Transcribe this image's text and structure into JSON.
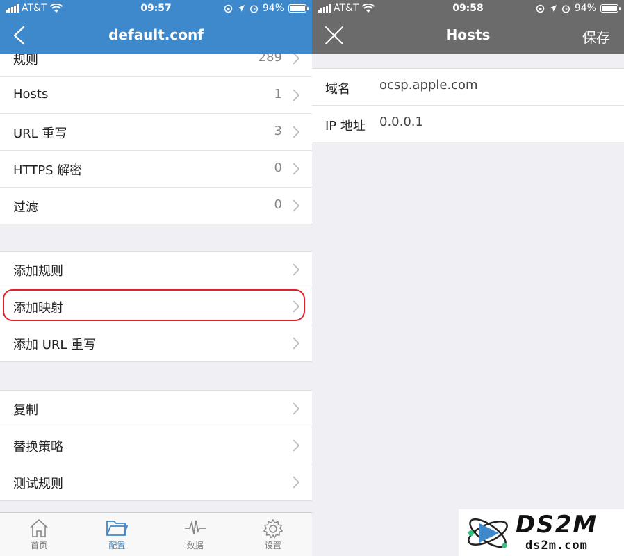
{
  "left": {
    "status": {
      "carrier": "AT&T",
      "time": "09:57",
      "battery": "94%"
    },
    "nav": {
      "title": "default.conf"
    },
    "groups": [
      {
        "rows": [
          {
            "label": "规则",
            "count": "289"
          },
          {
            "label": "Hosts",
            "count": "1"
          },
          {
            "label": "URL 重写",
            "count": "3"
          },
          {
            "label": "HTTPS 解密",
            "count": "0"
          },
          {
            "label": "过滤",
            "count": "0"
          }
        ]
      },
      {
        "rows": [
          {
            "label": "添加规则"
          },
          {
            "label": "添加映射"
          },
          {
            "label": "添加 URL 重写"
          }
        ]
      },
      {
        "rows": [
          {
            "label": "复制"
          },
          {
            "label": "替换策略"
          },
          {
            "label": "测试规则"
          }
        ]
      }
    ],
    "tabs": [
      {
        "label": "首页",
        "icon": "home-icon"
      },
      {
        "label": "配置",
        "icon": "folder-icon",
        "active": true
      },
      {
        "label": "数据",
        "icon": "waveform-icon"
      },
      {
        "label": "设置",
        "icon": "gear-icon"
      }
    ],
    "colors": {
      "accent": "#3e88cc",
      "highlight": "#e0202a"
    }
  },
  "right": {
    "status": {
      "carrier": "AT&T",
      "time": "09:58",
      "battery": "94%"
    },
    "nav": {
      "title": "Hosts",
      "save": "保存"
    },
    "form": {
      "domain_label": "域名",
      "domain_value": "ocsp.apple.com",
      "ip_label": "IP 地址",
      "ip_value": "0.0.0.1"
    },
    "colors": {
      "nav": "#6b6b6b"
    }
  },
  "watermark": {
    "brand": "DS2M",
    "url": "ds2m.com"
  }
}
